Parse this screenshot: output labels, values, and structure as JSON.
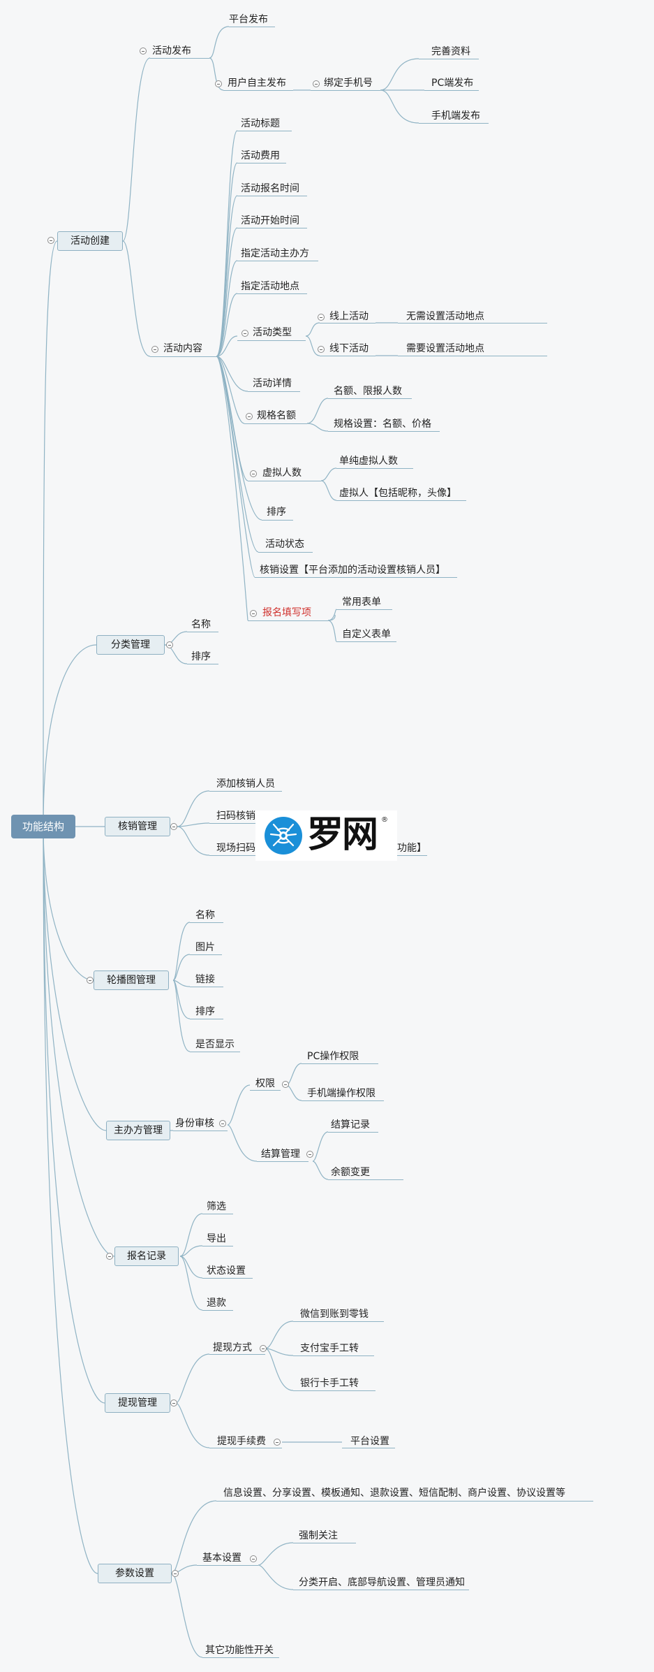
{
  "root": "功能结构",
  "l1": {
    "activity_create": "活动创建",
    "category": "分类管理",
    "writeoff": "核销管理",
    "carousel": "轮播图管理",
    "organizer": "主办方管理",
    "signup_records": "报名记录",
    "withdraw": "提现管理",
    "params": "参数设置"
  },
  "create": {
    "publish": "活动发布",
    "platform_publish": "平台发布",
    "user_publish": "用户自主发布",
    "bind_phone": "绑定手机号",
    "complete_info": "完善资料",
    "pc_publish": "PC端发布",
    "mobile_publish": "手机端发布",
    "content": "活动内容",
    "title": "活动标题",
    "fee": "活动费用",
    "signup_time": "活动报名时间",
    "start_time": "活动开始时间",
    "host": "指定活动主办方",
    "location": "指定活动地点",
    "type": "活动类型",
    "online": "线上活动",
    "online_note": "无需设置活动地点",
    "offline": "线下活动",
    "offline_note": "需要设置活动地点",
    "details": "活动详情",
    "spec_quota": "规格名额",
    "quota_limit": "名额、限报人数",
    "spec_setting": "规格设置：名额、价格",
    "virtual_count": "虚拟人数",
    "pure_virtual": "单纯虚拟人数",
    "virtual_person": "虚拟人【包括昵称，头像】",
    "sort": "排序",
    "status": "活动状态",
    "writeoff_setting": "核销设置【平台添加的活动设置核销人员】",
    "form_items": "报名填写项",
    "common_form": "常用表单",
    "custom_form": "自定义表单"
  },
  "category": {
    "name": "名称",
    "sort": "排序"
  },
  "writeoff": {
    "add_staff": "添加核销人员",
    "scan_writeoff": "扫码核销",
    "onsite_scan": "现场扫码",
    "onsite_tail": "功能】"
  },
  "carousel": {
    "name": "名称",
    "image": "图片",
    "link": "链接",
    "sort": "排序",
    "visible": "是否显示"
  },
  "organizer": {
    "identity_review": "身份审核",
    "permissions": "权限",
    "pc_perm": "PC操作权限",
    "mobile_perm": "手机端操作权限",
    "settlement": "结算管理",
    "settle_records": "结算记录",
    "balance_change": "余额变更"
  },
  "records": {
    "filter": "筛选",
    "export": "导出",
    "status_setting": "状态设置",
    "refund": "退款"
  },
  "withdraw": {
    "method": "提现方式",
    "wechat": "微信到账到零钱",
    "alipay": "支付宝手工转",
    "bankcard": "银行卡手工转",
    "fee": "提现手续费",
    "platform_setting": "平台设置"
  },
  "params": {
    "info": "信息设置、分享设置、模板通知、退款设置、短信配制、商户设置、协议设置等",
    "basic": "基本设置",
    "force_follow": "强制关注",
    "misc": "分类开启、底部导航设置、管理员通知",
    "other_switches": "其它功能性开关"
  },
  "watermark": {
    "text": "罗网",
    "reg": "®"
  },
  "colors": {
    "line": "#8fb3c4",
    "root": "#6f93b1",
    "node_fill": "#e6eef2",
    "highlight": "#d0312d"
  }
}
